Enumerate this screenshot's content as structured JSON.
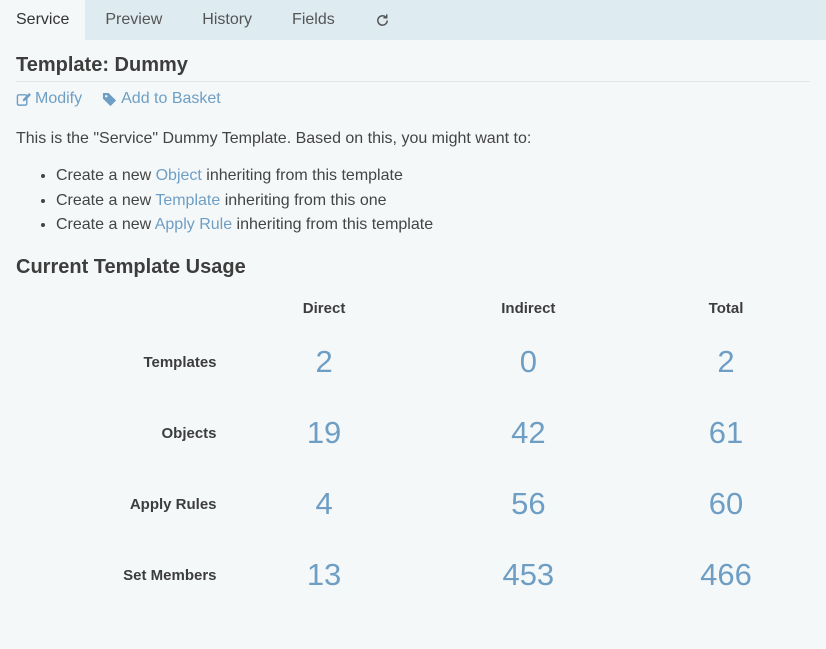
{
  "tabs": {
    "service": "Service",
    "preview": "Preview",
    "history": "History",
    "fields": "Fields",
    "refresh_icon": "refresh-icon"
  },
  "page": {
    "title": "Template: Dummy"
  },
  "actions": {
    "modify": "Modify",
    "add_to_basket": "Add to Basket",
    "modify_icon": "edit-icon",
    "basket_icon": "tag-icon"
  },
  "intro": "This is the \"Service\" Dummy Template. Based on this, you might want to:",
  "suggestions": [
    {
      "prefix": "Create a new ",
      "link": "Object",
      "suffix": " inheriting from this template"
    },
    {
      "prefix": "Create a new ",
      "link": "Template",
      "suffix": " inheriting from this one"
    },
    {
      "prefix": "Create a new ",
      "link": "Apply Rule",
      "suffix": " inheriting from this template"
    }
  ],
  "usage": {
    "title": "Current Template Usage",
    "headers": [
      "Direct",
      "Indirect",
      "Total"
    ],
    "rows": [
      {
        "label": "Templates",
        "direct": "2",
        "indirect": "0",
        "total": "2"
      },
      {
        "label": "Objects",
        "direct": "19",
        "indirect": "42",
        "total": "61"
      },
      {
        "label": "Apply Rules",
        "direct": "4",
        "indirect": "56",
        "total": "60"
      },
      {
        "label": "Set Members",
        "direct": "13",
        "indirect": "453",
        "total": "466"
      }
    ]
  },
  "colors": {
    "link": "#6e9ec4",
    "tabbar": "#deebf0",
    "background": "#f5f8f9"
  }
}
